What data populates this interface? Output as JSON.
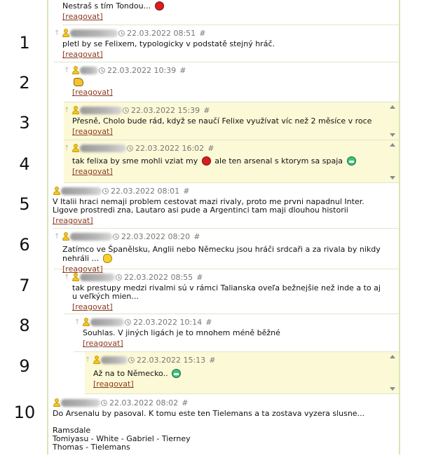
{
  "row_numbers": [
    "1",
    "2",
    "3",
    "4",
    "5",
    "6",
    "7",
    "8",
    "9",
    "10"
  ],
  "reply_label": "[reagovat]",
  "top": {
    "text": "Nestraš s tím Tondou..."
  },
  "comments": [
    {
      "date": "22.03.2022 08:51",
      "hash": "#",
      "text": "pletl by se Felixem, typologicky v podstatě stejný hráč."
    },
    {
      "date": "22.03.2022 10:39",
      "hash": "#"
    },
    {
      "date": "22.03.2022 15:39",
      "hash": "#",
      "text": "Přesně, Cholo bude rád, když se naučí Felixe využívat víc než 2 měsíce v roce"
    },
    {
      "date": "22.03.2022 16:02",
      "hash": "#",
      "text_a": "tak felixa by sme mohli vziat my",
      "text_b": "ale ten arsenal s ktorym sa spaja"
    },
    {
      "date": "22.03.2022 08:01",
      "hash": "#",
      "text": "V Italii hraci nemaji problem cestovat mazi rivaly, proto me prvni napadnul Inter. Ligove prostredi zna, Lautaro asi pude a Argentinci tam maji dlouhou historii"
    },
    {
      "date": "22.03.2022 08:20",
      "hash": "#",
      "text": "Zatímco ve Španělsku, Anglii nebo Německu jsou hráči srdcaři a za rivala by nikdy nehráli ..."
    },
    {
      "date": "22.03.2022 08:55",
      "hash": "#",
      "text": "tak prestupy medzi rivalmi sú v rámci Talianska oveľa bežnejšie než inde a to aj u veľkých mien..."
    },
    {
      "date": "22.03.2022 10:14",
      "hash": "#",
      "text": "Souhlas. V jiných ligách je to mnohem méně běžné"
    },
    {
      "date": "22.03.2022 15:13",
      "hash": "#",
      "text": "Až na to Německo.."
    },
    {
      "date": "22.03.2022 08:02",
      "hash": "#",
      "text": "Do Arsenalu by pasoval. K tomu este ten Tielemans a ta zostava vyzera slusne...",
      "lineup": [
        "Ramsdale",
        "Tomiyasu - White - Gabriel - Tierney",
        "Thomas - Tielemans"
      ]
    }
  ],
  "icons": {
    "user": "user-icon",
    "clock": "clock-icon",
    "reply": "reply-arrow-icon"
  },
  "colors": {
    "highlight": "#fcf9d7",
    "link": "#8b3a1f",
    "border": "#d9e6b5"
  }
}
